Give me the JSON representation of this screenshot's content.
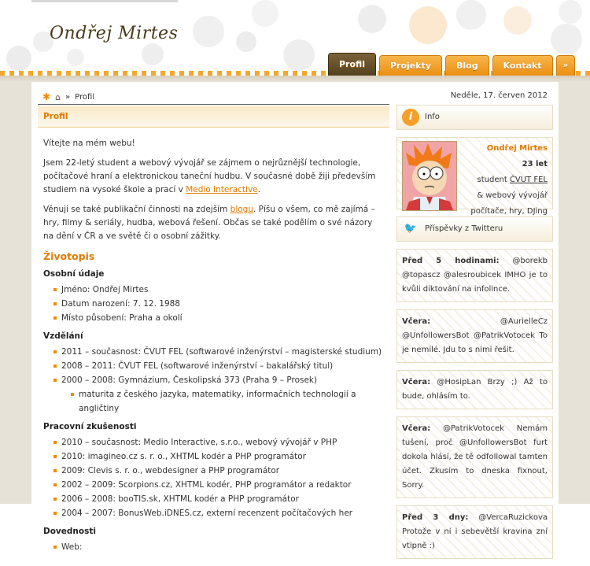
{
  "site": {
    "logo": "Ondřej Mirtes"
  },
  "nav": {
    "tabs": [
      {
        "label": "Profil",
        "active": true
      },
      {
        "label": "Projekty"
      },
      {
        "label": "Blog"
      },
      {
        "label": "Kontakt"
      },
      {
        "label": "»"
      }
    ]
  },
  "breadcrumb": {
    "current": "Profil"
  },
  "date": "Neděle, 17. červen 2012",
  "main": {
    "heading": "Profil",
    "welcome": "Vítejte na mém webu!",
    "p1_a": "Jsem 22-letý student a webový vývojář se zájmem o nejrůznější technologie, počítačové hraní a elektronickou taneční hudbu. V současné době žiji především studiem na vysoké škole a prací v ",
    "p1_link": "Medio Interactive",
    "p1_b": ".",
    "p2_a": "Věnuji se také publikační činnosti na zdejším ",
    "p2_link": "blogu",
    "p2_b": ". Píšu o všem, co mě zajímá – hry, filmy & seriály, hudba, webová řešení. Občas se také podělím o své názory na dění v ČR a ve světě či o osobní zážitky.",
    "cv_title": "Životopis",
    "personal_title": "Osobní údaje",
    "personal": [
      "Jméno: Ondřej Mirtes",
      "Datum narození: 7. 12. 1988",
      "Místo působení: Praha a okolí"
    ],
    "edu_title": "Vzdělání",
    "edu": [
      "2011 – současnost: ČVUT FEL (softwarové inženýrství – magisterské studium)",
      "2008 – 2011: ČVUT FEL (softwarové inženýrství – bakalářský titul)",
      "2000 – 2008: Gymnázium, Českolipská 373 (Praha 9 – Prosek)"
    ],
    "edu_sub": "maturita z českého jazyka, matematiky, informačních technologií a angličtiny",
    "work_title": "Pracovní zkušenosti",
    "work": [
      "2010 – současnost: Medio Interactive, s.r.o., webový vývojář v PHP",
      "2010: imagineo.cz s. r. o., XHTML kodér a PHP programátor",
      "2009: Clevis s. r. o., webdesigner a PHP programátor",
      "2002 – 2009: Scorpions.cz, XHTML kodér, PHP programátor a redaktor",
      "2006 – 2008: booTIS.sk, XHTML kodér a PHP programátor",
      "2004 – 2007: BonusWeb.iDNES.cz, externí recenzent počítačových her"
    ],
    "skills_title": "Dovednosti",
    "skills": [
      "Web:"
    ]
  },
  "sidebar": {
    "info_title": "Info",
    "name": "Ondřej Mirtes",
    "age": "23 let",
    "line1_a": "student ",
    "line1_link": "ČVUT FEL",
    "line2": "& webový vývojář",
    "line3": "počítače, hry, DJing",
    "twitter_title": "Příspěvky z Twitteru",
    "tweets": [
      {
        "when": "Před 5 hodinami:",
        "text": " @borekb @topascz @alesroubicek IMHO je to kvůli diktování na infolince."
      },
      {
        "when": "Včera:",
        "text": " @AurielleCz @UnfollowersBot @PatrikVotocek To je nemilé. Jdu to s nimi řešit."
      },
      {
        "when": "Včera:",
        "text": " @HosipLan Brzy ;) Až to bude, ohlásím to."
      },
      {
        "when": "Včera:",
        "text": " @PatrikVotocek Nemám tušení, proč @UnfollowersBot furt dokola hlásí, že tě odfollowal tamten účet. Zkusím to dneska fixnout, Sorry."
      },
      {
        "when": "Před 3 dny:",
        "text": " @VercaRuzickova Protože v ní i sebevětší kravina zní vtipně :)"
      }
    ]
  },
  "icons": {
    "star": "star-icon",
    "home": "home-icon",
    "info": "info-icon",
    "bird": "twitter-bird-icon"
  },
  "colors": {
    "accent": "#e07a00",
    "tab_active": "#54411f",
    "band": "#e7e2d7"
  }
}
